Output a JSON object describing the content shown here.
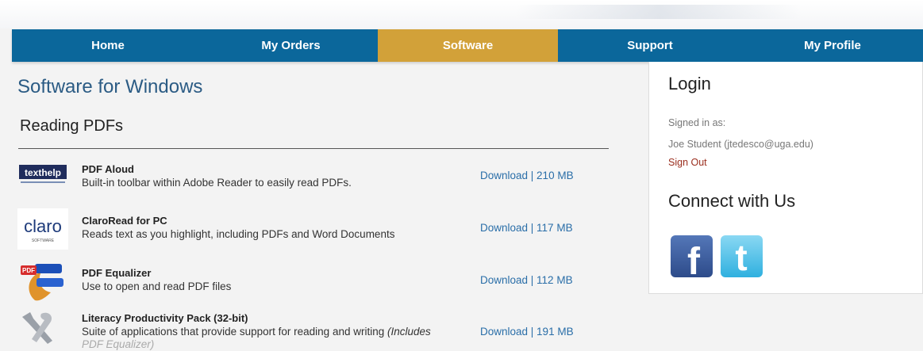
{
  "nav": {
    "items": [
      {
        "label": "Home",
        "active": false
      },
      {
        "label": "My Orders",
        "active": false
      },
      {
        "label": "Software",
        "active": true
      },
      {
        "label": "Support",
        "active": false
      },
      {
        "label": "My Profile",
        "active": false
      }
    ],
    "colors": {
      "bar": "#0b679b",
      "active": "#d2a139"
    }
  },
  "main": {
    "title": "Software for Windows",
    "section": "Reading PDFs",
    "items": [
      {
        "name": "PDF Aloud",
        "description": "Built-in toolbar within Adobe Reader to easily read PDFs.",
        "download": "Download | 210 MB",
        "icon": "texthelp-logo-icon",
        "logo_text": "texthelp"
      },
      {
        "name": "ClaroRead for PC",
        "description": "Reads text as you highlight, including PDFs and Word Documents",
        "download": "Download | 117 MB",
        "icon": "claro-logo-icon",
        "logo_text": "claro",
        "logo_subtext": "SOFTWARE"
      },
      {
        "name": "PDF Equalizer",
        "description": "Use to open and read PDF files",
        "download": "Download | 112 MB",
        "icon": "pdf-equalizer-icon",
        "logo_text": "PDF"
      },
      {
        "name": "Literacy Productivity Pack (32-bit)",
        "description": "Suite of applications that provide support for reading and writing ",
        "description_extra": "(Includes",
        "description_cut": "PDF Equalizer)",
        "download": "Download | 191 MB",
        "icon": "tools-icon"
      }
    ]
  },
  "sidebar": {
    "login_title": "Login",
    "signed_in_label": "Signed in as:",
    "signed_in_user": "Joe Student (jtedesco@uga.edu)",
    "sign_out": "Sign Out",
    "connect_title": "Connect with Us",
    "social": [
      {
        "name": "facebook-icon",
        "glyph": "f"
      },
      {
        "name": "twitter-icon",
        "glyph": "t"
      }
    ]
  }
}
